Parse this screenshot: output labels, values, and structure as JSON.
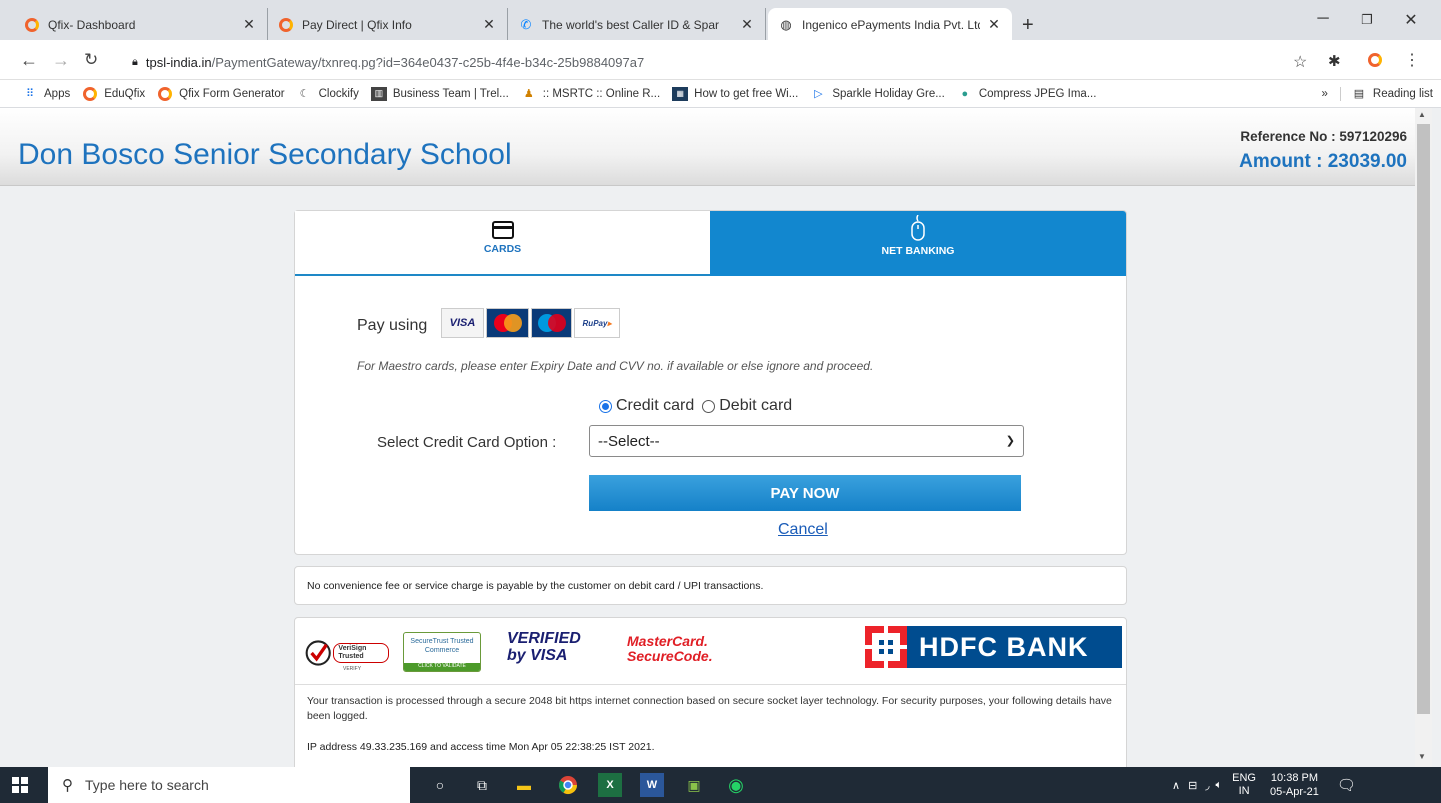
{
  "browser": {
    "tabs": [
      {
        "title": "Qfix- Dashboard",
        "icon": "qfix-icon",
        "active": false
      },
      {
        "title": "Pay Direct | Qfix Info",
        "icon": "qfix-icon",
        "active": false
      },
      {
        "title": "The world's best Caller ID & Spar",
        "icon": "truecaller-icon",
        "active": false
      },
      {
        "title": "Ingenico ePayments India Pvt. Ltd",
        "icon": "globe-icon",
        "active": true
      }
    ],
    "new_tab": "+",
    "url_host": "tpsl-india.in",
    "url_path": "/PaymentGateway/txnreq.pg?id=364e0437-c25b-4f4e-b34c-25b9884097a7",
    "bookmarks": [
      "Apps",
      "EduQfix",
      "Qfix Form Generator",
      "Clockify",
      "Business Team | Trel...",
      ":: MSRTC :: Online R...",
      "How to get free Wi...",
      "Sparkle Holiday Gre...",
      "Compress JPEG Ima..."
    ],
    "more_bookmarks": "»",
    "reading_list": "Reading list"
  },
  "header": {
    "school_name": "Don Bosco Senior Secondary School",
    "reference": "Reference No : 597120296",
    "amount": "Amount : 23039.00"
  },
  "payment": {
    "tab_cards": "CARDS",
    "tab_netbanking": "NET BANKING",
    "pay_using": "Pay using",
    "card_logos": [
      "VISA",
      "MasterCard",
      "Maestro",
      "RuPay"
    ],
    "maestro_note": "For Maestro cards, please enter Expiry Date and CVV no. if available or else ignore and proceed.",
    "radio_credit": "Credit card",
    "radio_debit": "Debit card",
    "select_label": "Select Credit Card Option :",
    "select_value": "--Select--",
    "pay_now": "PAY NOW",
    "cancel": "Cancel"
  },
  "fee_notice": "No convenience fee or service charge is payable by the customer on debit card / UPI transactions.",
  "security": {
    "badges": [
      "VeriSign Trusted",
      "SecureTrust Trusted Commerce",
      "VERIFIED by VISA",
      "MasterCard. SecureCode.",
      "HDFC BANK"
    ],
    "verisign_sub": "VERIFY",
    "securetrust_sub": "CLICK TO VALIDATE",
    "text": "Your transaction is processed through a secure 2048 bit https internet connection based on secure socket layer technology. For security purposes, your following details have been logged.",
    "ip_line": "IP address 49.33.235.169 and access time Mon Apr 05 22:38:25 IST 2021."
  },
  "taskbar": {
    "search_placeholder": "Type here to search",
    "lang": "ENG",
    "region": "IN",
    "time": "10:38 PM",
    "date": "05-Apr-21"
  },
  "colors": {
    "brand_blue": "#1e73be",
    "netbanking_tab": "#1287cf",
    "hdfc_blue": "#004c8f",
    "hdfc_red": "#ed232a"
  }
}
